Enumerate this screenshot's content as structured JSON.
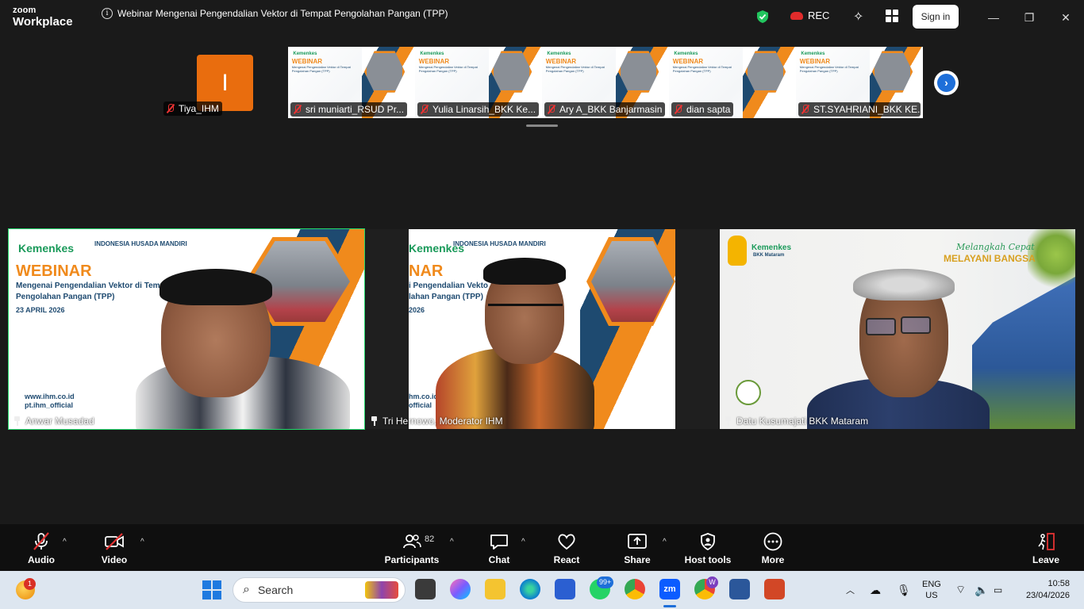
{
  "window": {
    "logo_top": "zoom",
    "logo_bottom": "Workplace",
    "title": "Webinar Mengenai Pengendalian Vektor di Tempat Pengolahan Pangan (TPP)",
    "rec_label": "REC",
    "signin_label": "Sign in"
  },
  "thumbnails": {
    "self_initial": "I",
    "self_name": "Tiya_IHM",
    "participants": [
      {
        "name": "sri muniarti_RSUD Pr..."
      },
      {
        "name": "Yulia Linarsih_BKK Ke..."
      },
      {
        "name": "Ary A_BKK Banjarmasin"
      },
      {
        "name": "dian sapta"
      },
      {
        "name": "ST.SYAHRIANI_BKK KE..."
      }
    ],
    "slide_kemenkes": "Kemenkes",
    "slide_webinar": "WEBINAR",
    "slide_sub": "Mengenai Pengendalian Vektor di Tempat Pengolahan Pangan (TPP)",
    "slide_date": "23 APRIL 2026"
  },
  "videos": [
    {
      "name": "Anwar Musadad",
      "kemenkes": "Kemenkes",
      "org": "INDONESIA HUSADA MANDIRI",
      "webinar": "WEBINAR",
      "sub1": "Mengenai Pengendalian Vektor di Tempat",
      "sub2": "Pengolahan Pangan (TPP)",
      "date": "23 APRIL 2026",
      "contact1": "www.ihm.co.id",
      "contact2": "pt.ihm_official"
    },
    {
      "name": "Tri  Hernowo, Moderator IHM",
      "kemenkes": "Kemenkes",
      "org": "INDONESIA HUSADA MANDIRI",
      "webinar": "NAR",
      "sub1": "i Pengendalian Vekto",
      "sub2": "lahan Pangan (TPP)",
      "date": "2026",
      "contact1": "hm.co.id",
      "contact2": "official"
    },
    {
      "name": "Datu Kusumajati BKK Mataram",
      "kemenkes": "Kemenkes",
      "org_sub": "BKK Mataram",
      "slogan1": "Melangkah Cepat",
      "slogan2": "MELAYANI BANGSA"
    }
  ],
  "toolbar": {
    "audio": "Audio",
    "video": "Video",
    "participants": "Participants",
    "participants_count": "82",
    "chat": "Chat",
    "react": "React",
    "share": "Share",
    "host_tools": "Host tools",
    "more": "More",
    "leave": "Leave"
  },
  "taskbar": {
    "weather_badge": "1",
    "search_placeholder": "Search",
    "whatsapp_badge": "99+",
    "chrome_profile_badge": "W",
    "lang_top": "ENG",
    "lang_bottom": "US",
    "time": "10:58",
    "date": "23/04/2026"
  },
  "colors": {
    "accent_green": "#23d96b",
    "orange": "#e96d0e",
    "zoom_blue": "#1e6fd9",
    "mute_red": "#e33333"
  }
}
